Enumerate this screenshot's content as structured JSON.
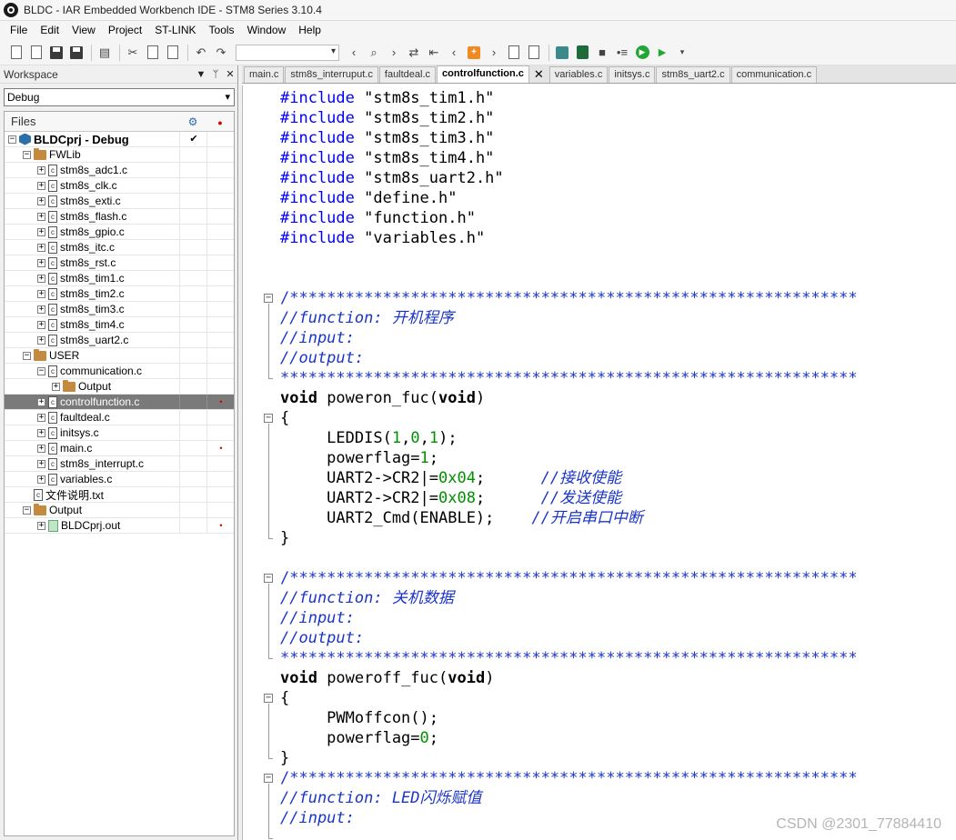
{
  "window": {
    "title": "BLDC - IAR Embedded Workbench IDE - STM8 Series 3.10.4"
  },
  "menu": [
    "File",
    "Edit",
    "View",
    "Project",
    "ST-LINK",
    "Tools",
    "Window",
    "Help"
  ],
  "workspace": {
    "title": "Workspace",
    "config": "Debug",
    "files_header": "Files",
    "tree": [
      {
        "label": "BLDCprj - Debug",
        "depth": 0,
        "type": "project",
        "expander": "minus",
        "check": true,
        "dot": false
      },
      {
        "label": "FWLib",
        "depth": 1,
        "type": "folder",
        "expander": "minus",
        "dot": false
      },
      {
        "label": "stm8s_adc1.c",
        "depth": 2,
        "type": "file",
        "expander": "plus",
        "dot": false
      },
      {
        "label": "stm8s_clk.c",
        "depth": 2,
        "type": "file",
        "expander": "plus",
        "dot": false
      },
      {
        "label": "stm8s_exti.c",
        "depth": 2,
        "type": "file",
        "expander": "plus",
        "dot": false
      },
      {
        "label": "stm8s_flash.c",
        "depth": 2,
        "type": "file",
        "expander": "plus",
        "dot": false
      },
      {
        "label": "stm8s_gpio.c",
        "depth": 2,
        "type": "file",
        "expander": "plus",
        "dot": false
      },
      {
        "label": "stm8s_itc.c",
        "depth": 2,
        "type": "file",
        "expander": "plus",
        "dot": false
      },
      {
        "label": "stm8s_rst.c",
        "depth": 2,
        "type": "file",
        "expander": "plus",
        "dot": false
      },
      {
        "label": "stm8s_tim1.c",
        "depth": 2,
        "type": "file",
        "expander": "plus",
        "dot": false
      },
      {
        "label": "stm8s_tim2.c",
        "depth": 2,
        "type": "file",
        "expander": "plus",
        "dot": false
      },
      {
        "label": "stm8s_tim3.c",
        "depth": 2,
        "type": "file",
        "expander": "plus",
        "dot": false
      },
      {
        "label": "stm8s_tim4.c",
        "depth": 2,
        "type": "file",
        "expander": "plus",
        "dot": false
      },
      {
        "label": "stm8s_uart2.c",
        "depth": 2,
        "type": "file",
        "expander": "plus",
        "dot": false
      },
      {
        "label": "USER",
        "depth": 1,
        "type": "folder",
        "expander": "minus",
        "dot": false
      },
      {
        "label": "communication.c",
        "depth": 2,
        "type": "file",
        "expander": "minus",
        "dot": false
      },
      {
        "label": "Output",
        "depth": 3,
        "type": "folder",
        "expander": "plus",
        "dot": false
      },
      {
        "label": "controlfunction.c",
        "depth": 2,
        "type": "file",
        "expander": "plus",
        "dot": true,
        "selected": true
      },
      {
        "label": "faultdeal.c",
        "depth": 2,
        "type": "file",
        "expander": "plus",
        "dot": false
      },
      {
        "label": "initsys.c",
        "depth": 2,
        "type": "file",
        "expander": "plus",
        "dot": false
      },
      {
        "label": "main.c",
        "depth": 2,
        "type": "file",
        "expander": "plus",
        "dot": true
      },
      {
        "label": "stm8s_interrupt.c",
        "depth": 2,
        "type": "file",
        "expander": "plus",
        "dot": false
      },
      {
        "label": "variables.c",
        "depth": 2,
        "type": "file",
        "expander": "plus",
        "dot": false
      },
      {
        "label": "文件说明.txt",
        "depth": 1,
        "type": "file",
        "expander": "none",
        "dot": false
      },
      {
        "label": "Output",
        "depth": 1,
        "type": "folder",
        "expander": "minus",
        "dot": false
      },
      {
        "label": "BLDCprj.out",
        "depth": 2,
        "type": "out",
        "expander": "plus",
        "dot": true
      }
    ]
  },
  "editor": {
    "tabs": [
      {
        "label": "main.c",
        "active": false
      },
      {
        "label": "stm8s_interruput.c",
        "active": false
      },
      {
        "label": "faultdeal.c",
        "active": false
      },
      {
        "label": "controlfunction.c",
        "active": true
      },
      {
        "label": "variables.c",
        "active": false
      },
      {
        "label": "initsys.c",
        "active": false
      },
      {
        "label": "stm8s_uart2.c",
        "active": false
      },
      {
        "label": "communication.c",
        "active": false
      }
    ],
    "lines": [
      [
        [
          "kw",
          "#include"
        ],
        [
          "str",
          " \"stm8s_tim1.h\""
        ]
      ],
      [
        [
          "kw",
          "#include"
        ],
        [
          "str",
          " \"stm8s_tim2.h\""
        ]
      ],
      [
        [
          "kw",
          "#include"
        ],
        [
          "str",
          " \"stm8s_tim3.h\""
        ]
      ],
      [
        [
          "kw",
          "#include"
        ],
        [
          "str",
          " \"stm8s_tim4.h\""
        ]
      ],
      [
        [
          "kw",
          "#include"
        ],
        [
          "str",
          " \"stm8s_uart2.h\""
        ]
      ],
      [
        [
          "kw",
          "#include"
        ],
        [
          "str",
          " \"define.h\""
        ]
      ],
      [
        [
          "kw",
          "#include"
        ],
        [
          "str",
          " \"function.h\""
        ]
      ],
      [
        [
          "kw",
          "#include"
        ],
        [
          "str",
          " \"variables.h\""
        ]
      ],
      [],
      [],
      [
        [
          "cmtbox",
          "/*************************************************************"
        ]
      ],
      [
        [
          "cmt",
          "//function: 开机程序"
        ]
      ],
      [
        [
          "cmt",
          "//input:"
        ]
      ],
      [
        [
          "cmt",
          "//output:"
        ]
      ],
      [
        [
          "cmtbox",
          "**************************************************************"
        ]
      ],
      [
        [
          "kwb",
          "void"
        ],
        [
          "",
          " poweron_fuc("
        ],
        [
          "kwb",
          "void"
        ],
        [
          "",
          ")"
        ]
      ],
      [
        [
          "",
          "{"
        ]
      ],
      [
        [
          "",
          "     LEDDIS("
        ],
        [
          "num",
          "1"
        ],
        [
          "",
          ","
        ],
        [
          "num",
          "0"
        ],
        [
          "",
          ","
        ],
        [
          "num",
          "1"
        ],
        [
          "",
          ");"
        ]
      ],
      [
        [
          "",
          "     powerflag="
        ],
        [
          "num",
          "1"
        ],
        [
          "",
          ";"
        ]
      ],
      [
        [
          "",
          "     UART2->CR2|="
        ],
        [
          "num",
          "0x04"
        ],
        [
          "",
          ";      "
        ],
        [
          "cmt",
          "//接收使能"
        ]
      ],
      [
        [
          "",
          "     UART2->CR2|="
        ],
        [
          "num",
          "0x08"
        ],
        [
          "",
          ";      "
        ],
        [
          "cmt",
          "//发送使能"
        ]
      ],
      [
        [
          "",
          "     UART2_Cmd(ENABLE);    "
        ],
        [
          "cmt",
          "//开启串口中断"
        ]
      ],
      [
        [
          "",
          "}"
        ]
      ],
      [],
      [
        [
          "cmtbox",
          "/*************************************************************"
        ]
      ],
      [
        [
          "cmt",
          "//function: 关机数据"
        ]
      ],
      [
        [
          "cmt",
          "//input:"
        ]
      ],
      [
        [
          "cmt",
          "//output:"
        ]
      ],
      [
        [
          "cmtbox",
          "**************************************************************"
        ]
      ],
      [
        [
          "kwb",
          "void"
        ],
        [
          "",
          " poweroff_fuc("
        ],
        [
          "kwb",
          "void"
        ],
        [
          "",
          ")"
        ]
      ],
      [
        [
          "",
          "{"
        ]
      ],
      [
        [
          "",
          "     PWMoffcon();"
        ]
      ],
      [
        [
          "",
          "     powerflag="
        ],
        [
          "num",
          "0"
        ],
        [
          "",
          ";"
        ]
      ],
      [
        [
          "",
          "}"
        ]
      ],
      [
        [
          "cmtbox",
          "/*************************************************************"
        ]
      ],
      [
        [
          "cmt",
          "//function: LED闪烁赋值"
        ]
      ],
      [
        [
          "cmt",
          "//input:"
        ]
      ]
    ]
  },
  "watermark": "CSDN @2301_77884410"
}
